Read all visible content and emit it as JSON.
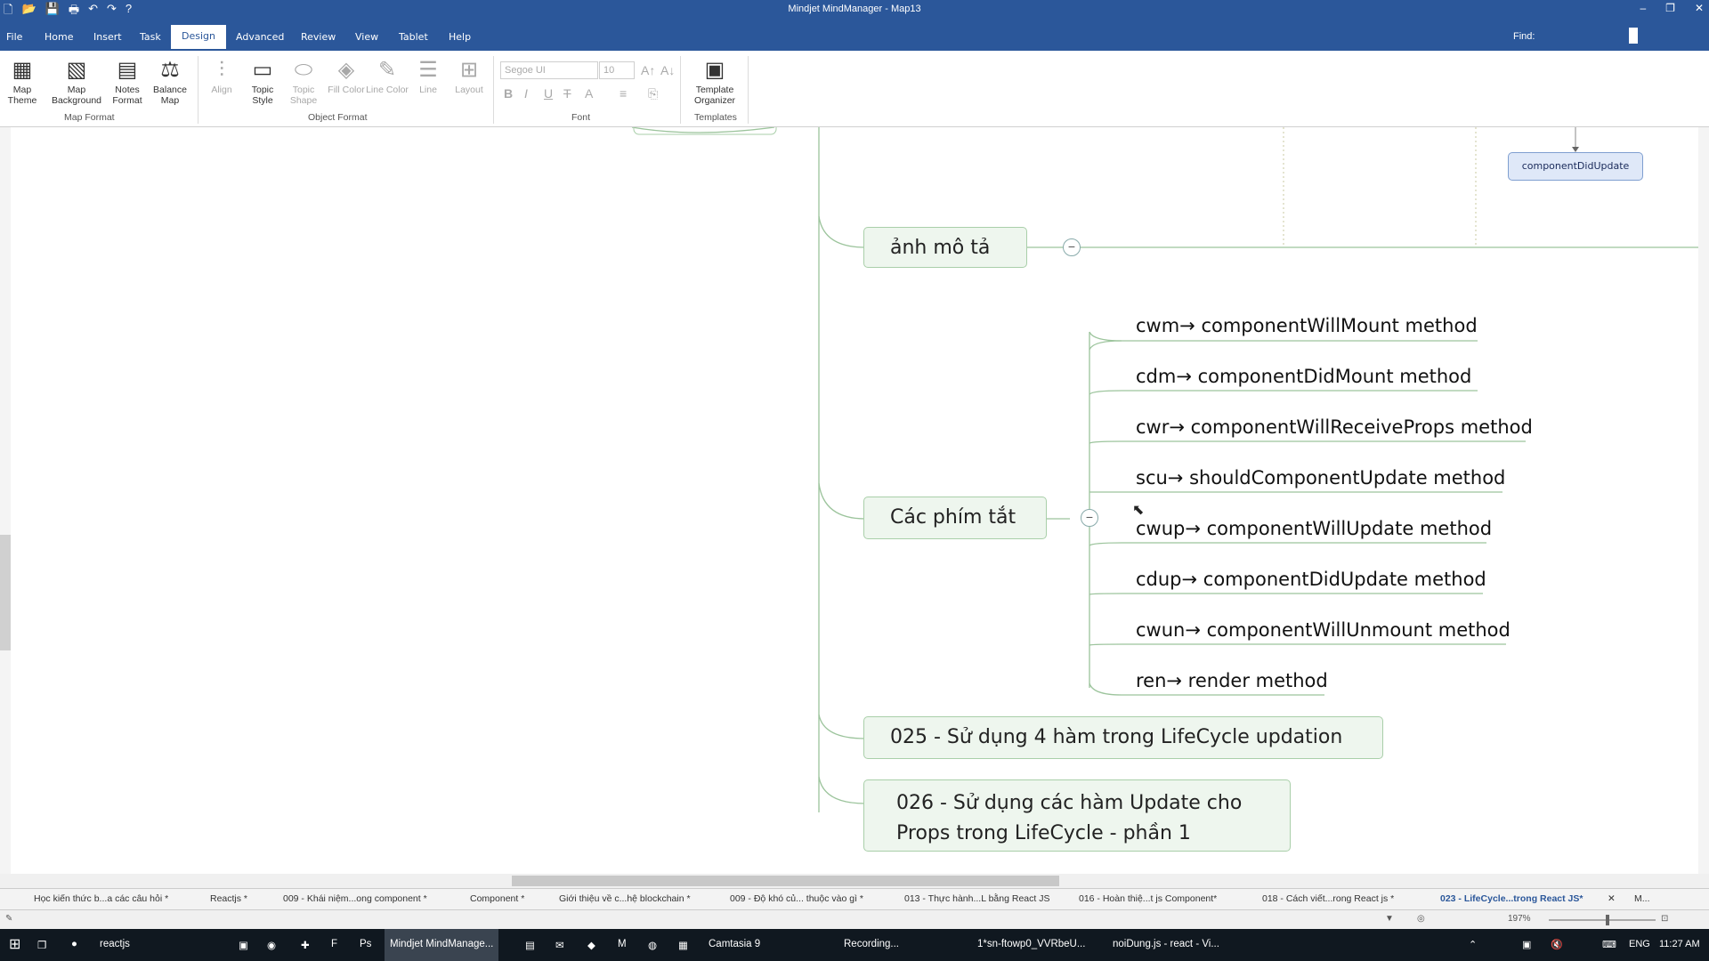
{
  "window": {
    "title": "Mindjet MindManager - Map13"
  },
  "menu": {
    "items": [
      "File",
      "Home",
      "Insert",
      "Task",
      "Design",
      "Advanced",
      "Review",
      "View",
      "Tablet",
      "Help"
    ],
    "active": "Design",
    "find_label": "Find:"
  },
  "ribbon": {
    "map_theme": "Map Theme",
    "map_background": "Map Background",
    "notes_format": "Notes Format",
    "balance_map": "Balance Map",
    "align": "Align",
    "topic_style": "Topic Style",
    "topic_shape": "Topic Shape",
    "fill_color": "Fill Color",
    "line_color": "Line Color",
    "line": "Line",
    "layout": "Layout",
    "font_name": "Segoe UI",
    "font_size": "10",
    "template_organizer": "Template Organizer",
    "groups": {
      "map_format": "Map Format",
      "object_format": "Object Format",
      "font": "Font",
      "templates": "Templates"
    }
  },
  "map": {
    "top_right_node": "componentDidUpdate",
    "node_anh_mo_ta": "ảnh mô tả",
    "node_cac_phim_tat": "Các phím tắt",
    "shortcuts": [
      "cwm→ componentWillMount method",
      "cdm→ componentDidMount method",
      "cwr→ componentWillReceiveProps method",
      "scu→ shouldComponentUpdate method",
      "cwup→ componentWillUpdate method",
      "cdup→ componentDidUpdate method",
      "cwun→ componentWillUnmount method",
      "ren→ render method"
    ],
    "node_025": "025 - Sử dụng 4 hàm trong LifeCycle updation",
    "node_026_line1": "026 - Sử dụng các hàm Update cho",
    "node_026_line2": "Props trong LifeCycle - phần 1"
  },
  "tabs": [
    "Học kiến thức b...a các câu hỏi *",
    "Reactjs *",
    "009 - Khái niệm...ong component *",
    "Component *",
    "Giới thiệu về c...hệ blockchain *",
    "009 - Độ khó củ... thuộc vào gì *",
    "013 - Thực hành...L bằng React JS",
    "016 - Hoàn thiệ...t js Component*",
    "018 - Cách viết...rong React js *",
    "023 - LifeCycle...trong React JS*",
    "M..."
  ],
  "status": {
    "zoom": "197%"
  },
  "taskbar": {
    "items": [
      "reactjs",
      "Mindjet MindManage...",
      "Camtasia 9",
      "Recording...",
      "1*sn-ftowp0_VVRbeU...",
      "noiDung.js - react - Vi..."
    ],
    "lang": "ENG",
    "time": "11:27 AM"
  }
}
